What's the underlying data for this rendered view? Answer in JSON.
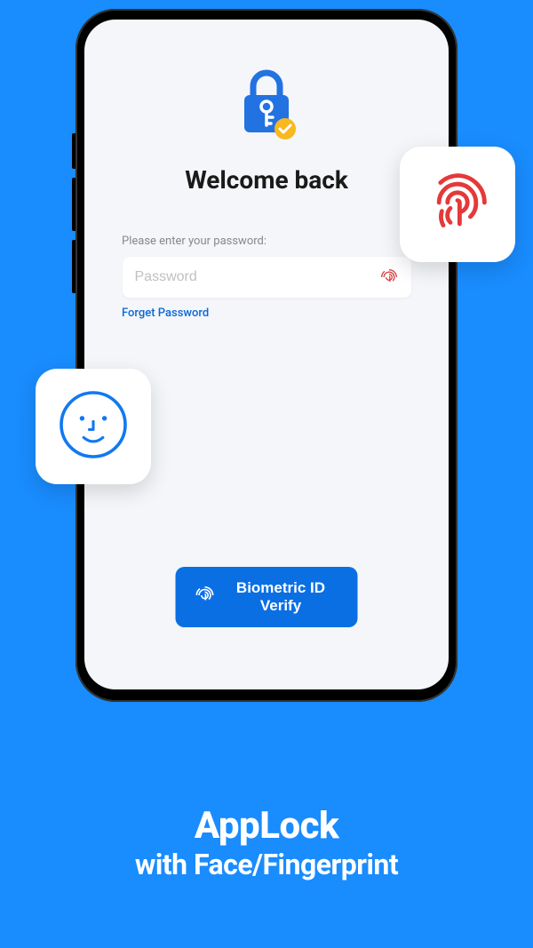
{
  "screen": {
    "title": "Welcome back",
    "subtitle": "Please enter your password:",
    "password_placeholder": "Password",
    "forgot_link": "Forget Password",
    "biometric_button": "Biometric ID Verify"
  },
  "promo": {
    "title": "AppLock",
    "subtitle": "with Face/Fingerprint"
  },
  "colors": {
    "background": "#198cfe",
    "primary": "#0b6fe4",
    "fingerprint_red": "#e53939",
    "lock_blue": "#2272e1",
    "badge_yellow": "#f9b820"
  }
}
